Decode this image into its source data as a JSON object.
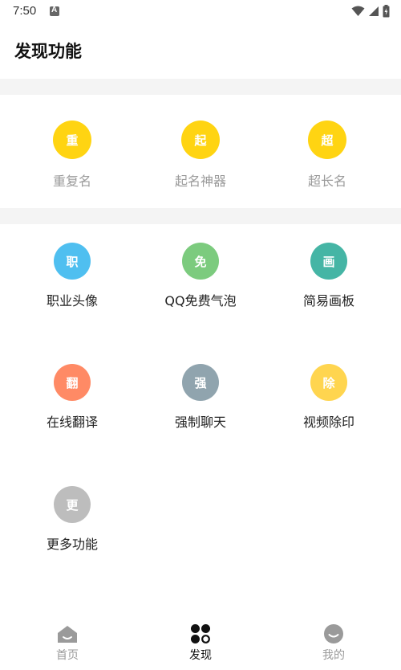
{
  "status": {
    "time": "7:50"
  },
  "page": {
    "title": "发现功能"
  },
  "section1": [
    {
      "glyph": "重",
      "label": "重复名",
      "color": "#FFD412"
    },
    {
      "glyph": "起",
      "label": "起名神器",
      "color": "#FFD412"
    },
    {
      "glyph": "超",
      "label": "超长名",
      "color": "#FFD412"
    }
  ],
  "section2": [
    {
      "glyph": "职",
      "label": "职业头像",
      "color": "#4FBFF0"
    },
    {
      "glyph": "免",
      "label": "QQ免费气泡",
      "color": "#7CCB7E"
    },
    {
      "glyph": "画",
      "label": "简易画板",
      "color": "#45B5A5"
    },
    {
      "glyph": "翻",
      "label": "在线翻译",
      "color": "#FF8A65"
    },
    {
      "glyph": "强",
      "label": "强制聊天",
      "color": "#90A4AE"
    },
    {
      "glyph": "除",
      "label": "视频除印",
      "color": "#FFD54F"
    },
    {
      "glyph": "更",
      "label": "更多功能",
      "color": "#BDBDBD"
    }
  ],
  "tabs": [
    {
      "label": "首页",
      "icon": "home-icon",
      "active": false
    },
    {
      "label": "发现",
      "icon": "discover-grid-icon",
      "active": true
    },
    {
      "label": "我的",
      "icon": "profile-smile-icon",
      "active": false
    }
  ],
  "colors": {
    "tab_active": "#111111",
    "tab_inactive": "#9a9a9a"
  }
}
